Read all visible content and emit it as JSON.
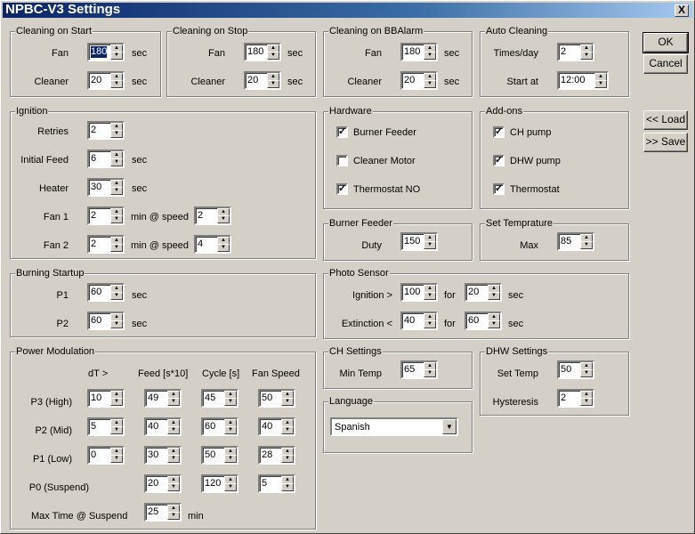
{
  "window": {
    "title": "NPBC-V3 Settings",
    "close_label": "X"
  },
  "buttons": {
    "ok": "OK",
    "cancel": "Cancel",
    "load": "<< Load",
    "save": ">> Save"
  },
  "units": {
    "sec": "sec",
    "min": "min",
    "min_at_speed": "min @ speed",
    "for": "for"
  },
  "cleaning_on_start": {
    "title": "Cleaning on Start",
    "fan_label": "Fan",
    "fan_value": "180",
    "cleaner_label": "Cleaner",
    "cleaner_value": "20"
  },
  "cleaning_on_stop": {
    "title": "Cleaning on Stop",
    "fan_label": "Fan",
    "fan_value": "180",
    "cleaner_label": "Cleaner",
    "cleaner_value": "20"
  },
  "cleaning_on_bbalarm": {
    "title": "Cleaning  on BBAlarm",
    "fan_label": "Fan",
    "fan_value": "180",
    "cleaner_label": "Cleaner",
    "cleaner_value": "20"
  },
  "auto_cleaning": {
    "title": "Auto Cleaning",
    "times_label": "Times/day",
    "times_value": "2",
    "start_label": "Start at",
    "start_value": "12:00"
  },
  "ignition": {
    "title": "Ignition",
    "retries_label": "Retries",
    "retries_value": "2",
    "initial_feed_label": "Initial Feed",
    "initial_feed_value": "6",
    "heater_label": "Heater",
    "heater_value": "30",
    "fan1_label": "Fan 1",
    "fan1_value": "2",
    "fan1_speed": "2",
    "fan2_label": "Fan 2",
    "fan2_value": "2",
    "fan2_speed": "4"
  },
  "hardware": {
    "title": "Hardware",
    "burner_feeder": {
      "label": "Burner Feeder",
      "checked": true
    },
    "cleaner_motor": {
      "label": "Cleaner Motor",
      "checked": false
    },
    "thermostat_no": {
      "label": "Thermostat NO",
      "checked": true
    }
  },
  "addons": {
    "title": "Add-ons",
    "ch_pump": {
      "label": "CH pump",
      "checked": true
    },
    "dhw_pump": {
      "label": "DHW pump",
      "checked": true
    },
    "thermostat": {
      "label": "Thermostat",
      "checked": true
    }
  },
  "burner_feeder": {
    "title": "Burner Feeder",
    "duty_label": "Duty",
    "duty_value": "150"
  },
  "set_temperature": {
    "title": "Set Temprature",
    "max_label": "Max",
    "max_value": "85"
  },
  "burning_startup": {
    "title": "Burning Startup",
    "p1_label": "P1",
    "p1_value": "60",
    "p2_label": "P2",
    "p2_value": "60"
  },
  "photo_sensor": {
    "title": "Photo Sensor",
    "ignition_label": "Ignition  >",
    "ignition_value": "100",
    "ignition_for": "20",
    "extinction_label": "Extinction  <",
    "extinction_value": "40",
    "extinction_for": "60"
  },
  "power_modulation": {
    "title": "Power Modulation",
    "headers": {
      "dt": "dT >",
      "feed": "Feed [s*10]",
      "cycle": "Cycle [s]",
      "fan_speed": "Fan Speed"
    },
    "rows": [
      {
        "label": "P3 (High)",
        "dt": "10",
        "feed": "49",
        "cycle": "45",
        "fan": "50"
      },
      {
        "label": "P2 (Mid)",
        "dt": "5",
        "feed": "40",
        "cycle": "60",
        "fan": "40"
      },
      {
        "label": "P1 (Low)",
        "dt": "0",
        "feed": "30",
        "cycle": "50",
        "fan": "28"
      },
      {
        "label": "P0 (Suspend)",
        "feed": "20",
        "cycle": "120",
        "fan": "5"
      }
    ],
    "max_time_label": "Max Time @ Suspend",
    "max_time_value": "25"
  },
  "ch_settings": {
    "title": "CH Settings",
    "min_temp_label": "Min Temp",
    "min_temp_value": "65"
  },
  "dhw_settings": {
    "title": "DHW Settings",
    "set_temp_label": "Set Temp",
    "set_temp_value": "50",
    "hysteresis_label": "Hysteresis",
    "hysteresis_value": "2"
  },
  "language": {
    "title": "Language",
    "selected": "Spanish"
  }
}
